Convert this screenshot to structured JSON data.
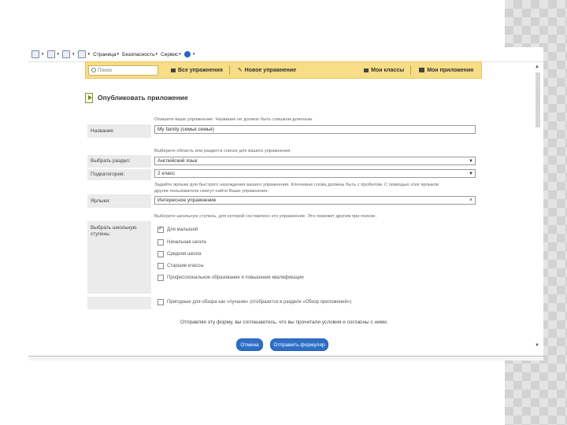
{
  "toolbar": {
    "page": "Страница",
    "security": "Безопасность",
    "service": "Сервис"
  },
  "appbar": {
    "search_placeholder": "Поиск",
    "all_exercises": "Все упражнения",
    "new_exercise": "Новое упражнение",
    "my_classes": "Мои классы",
    "my_apps": "Мои приложения"
  },
  "page_title": "Опубликовать приложение",
  "form": {
    "name_hint": "Опишите ваше упражнение. Название не должно быть слишком длинным.",
    "name_label": "Название",
    "name_value": "My family (семья семья)",
    "section_hint": "Выберите область или раздел в списке для вашего упражнения.",
    "section_label": "Выбрать раздел:",
    "section_value": "Английский язык",
    "subcategory_label": "Подкатегория:",
    "subcategory_value": "2 класс",
    "tags_hint_1": "Задайте ярлыки для быстрого нахождения вашего упражнения. Ключевые слова должны быть с пробелом. С помощью этих ярлыков",
    "tags_hint_2": "другие пользователи смогут найти Ваше упражнение.",
    "tags_label": "Ярлыки:",
    "tags_value": "Интересное упражнение",
    "level_hint": "Выберите школьную ступень, для которой составлено это упражнение. Это поможет другим при поиске.",
    "level_label_1": "Выбрать школьную",
    "level_label_2": "ступень:",
    "levels": [
      {
        "label": "Для малышей",
        "checked": true
      },
      {
        "label": "Начальная школа",
        "checked": false
      },
      {
        "label": "Средняя школа",
        "checked": false
      },
      {
        "label": "Старшие классы",
        "checked": false
      },
      {
        "label": "Профессиональное образование и повышение квалификации",
        "checked": false
      }
    ],
    "showcase_label": "Пригодные для обзора как «лучшие» (отобразится в разделе «Обзор приложений»)"
  },
  "agree_text": "Отправляя эту форму, вы соглашаетесь, что вы прочитали условия и согласны с ними.",
  "buttons": {
    "cancel": "Отмена",
    "submit": "Отправить формуляр"
  }
}
